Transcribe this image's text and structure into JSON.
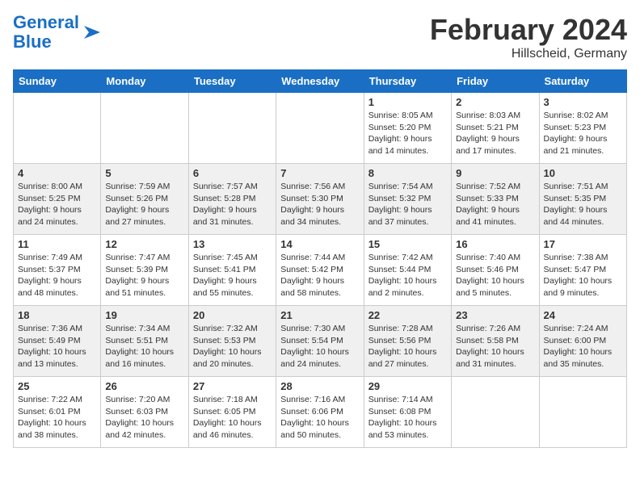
{
  "logo": {
    "text_general": "General",
    "text_blue": "Blue"
  },
  "header": {
    "month": "February 2024",
    "location": "Hillscheid, Germany"
  },
  "weekdays": [
    "Sunday",
    "Monday",
    "Tuesday",
    "Wednesday",
    "Thursday",
    "Friday",
    "Saturday"
  ],
  "weeks": [
    [
      {
        "num": "",
        "info": ""
      },
      {
        "num": "",
        "info": ""
      },
      {
        "num": "",
        "info": ""
      },
      {
        "num": "",
        "info": ""
      },
      {
        "num": "1",
        "info": "Sunrise: 8:05 AM\nSunset: 5:20 PM\nDaylight: 9 hours and 14 minutes."
      },
      {
        "num": "2",
        "info": "Sunrise: 8:03 AM\nSunset: 5:21 PM\nDaylight: 9 hours and 17 minutes."
      },
      {
        "num": "3",
        "info": "Sunrise: 8:02 AM\nSunset: 5:23 PM\nDaylight: 9 hours and 21 minutes."
      }
    ],
    [
      {
        "num": "4",
        "info": "Sunrise: 8:00 AM\nSunset: 5:25 PM\nDaylight: 9 hours and 24 minutes."
      },
      {
        "num": "5",
        "info": "Sunrise: 7:59 AM\nSunset: 5:26 PM\nDaylight: 9 hours and 27 minutes."
      },
      {
        "num": "6",
        "info": "Sunrise: 7:57 AM\nSunset: 5:28 PM\nDaylight: 9 hours and 31 minutes."
      },
      {
        "num": "7",
        "info": "Sunrise: 7:56 AM\nSunset: 5:30 PM\nDaylight: 9 hours and 34 minutes."
      },
      {
        "num": "8",
        "info": "Sunrise: 7:54 AM\nSunset: 5:32 PM\nDaylight: 9 hours and 37 minutes."
      },
      {
        "num": "9",
        "info": "Sunrise: 7:52 AM\nSunset: 5:33 PM\nDaylight: 9 hours and 41 minutes."
      },
      {
        "num": "10",
        "info": "Sunrise: 7:51 AM\nSunset: 5:35 PM\nDaylight: 9 hours and 44 minutes."
      }
    ],
    [
      {
        "num": "11",
        "info": "Sunrise: 7:49 AM\nSunset: 5:37 PM\nDaylight: 9 hours and 48 minutes."
      },
      {
        "num": "12",
        "info": "Sunrise: 7:47 AM\nSunset: 5:39 PM\nDaylight: 9 hours and 51 minutes."
      },
      {
        "num": "13",
        "info": "Sunrise: 7:45 AM\nSunset: 5:41 PM\nDaylight: 9 hours and 55 minutes."
      },
      {
        "num": "14",
        "info": "Sunrise: 7:44 AM\nSunset: 5:42 PM\nDaylight: 9 hours and 58 minutes."
      },
      {
        "num": "15",
        "info": "Sunrise: 7:42 AM\nSunset: 5:44 PM\nDaylight: 10 hours and 2 minutes."
      },
      {
        "num": "16",
        "info": "Sunrise: 7:40 AM\nSunset: 5:46 PM\nDaylight: 10 hours and 5 minutes."
      },
      {
        "num": "17",
        "info": "Sunrise: 7:38 AM\nSunset: 5:47 PM\nDaylight: 10 hours and 9 minutes."
      }
    ],
    [
      {
        "num": "18",
        "info": "Sunrise: 7:36 AM\nSunset: 5:49 PM\nDaylight: 10 hours and 13 minutes."
      },
      {
        "num": "19",
        "info": "Sunrise: 7:34 AM\nSunset: 5:51 PM\nDaylight: 10 hours and 16 minutes."
      },
      {
        "num": "20",
        "info": "Sunrise: 7:32 AM\nSunset: 5:53 PM\nDaylight: 10 hours and 20 minutes."
      },
      {
        "num": "21",
        "info": "Sunrise: 7:30 AM\nSunset: 5:54 PM\nDaylight: 10 hours and 24 minutes."
      },
      {
        "num": "22",
        "info": "Sunrise: 7:28 AM\nSunset: 5:56 PM\nDaylight: 10 hours and 27 minutes."
      },
      {
        "num": "23",
        "info": "Sunrise: 7:26 AM\nSunset: 5:58 PM\nDaylight: 10 hours and 31 minutes."
      },
      {
        "num": "24",
        "info": "Sunrise: 7:24 AM\nSunset: 6:00 PM\nDaylight: 10 hours and 35 minutes."
      }
    ],
    [
      {
        "num": "25",
        "info": "Sunrise: 7:22 AM\nSunset: 6:01 PM\nDaylight: 10 hours and 38 minutes."
      },
      {
        "num": "26",
        "info": "Sunrise: 7:20 AM\nSunset: 6:03 PM\nDaylight: 10 hours and 42 minutes."
      },
      {
        "num": "27",
        "info": "Sunrise: 7:18 AM\nSunset: 6:05 PM\nDaylight: 10 hours and 46 minutes."
      },
      {
        "num": "28",
        "info": "Sunrise: 7:16 AM\nSunset: 6:06 PM\nDaylight: 10 hours and 50 minutes."
      },
      {
        "num": "29",
        "info": "Sunrise: 7:14 AM\nSunset: 6:08 PM\nDaylight: 10 hours and 53 minutes."
      },
      {
        "num": "",
        "info": ""
      },
      {
        "num": "",
        "info": ""
      }
    ]
  ]
}
